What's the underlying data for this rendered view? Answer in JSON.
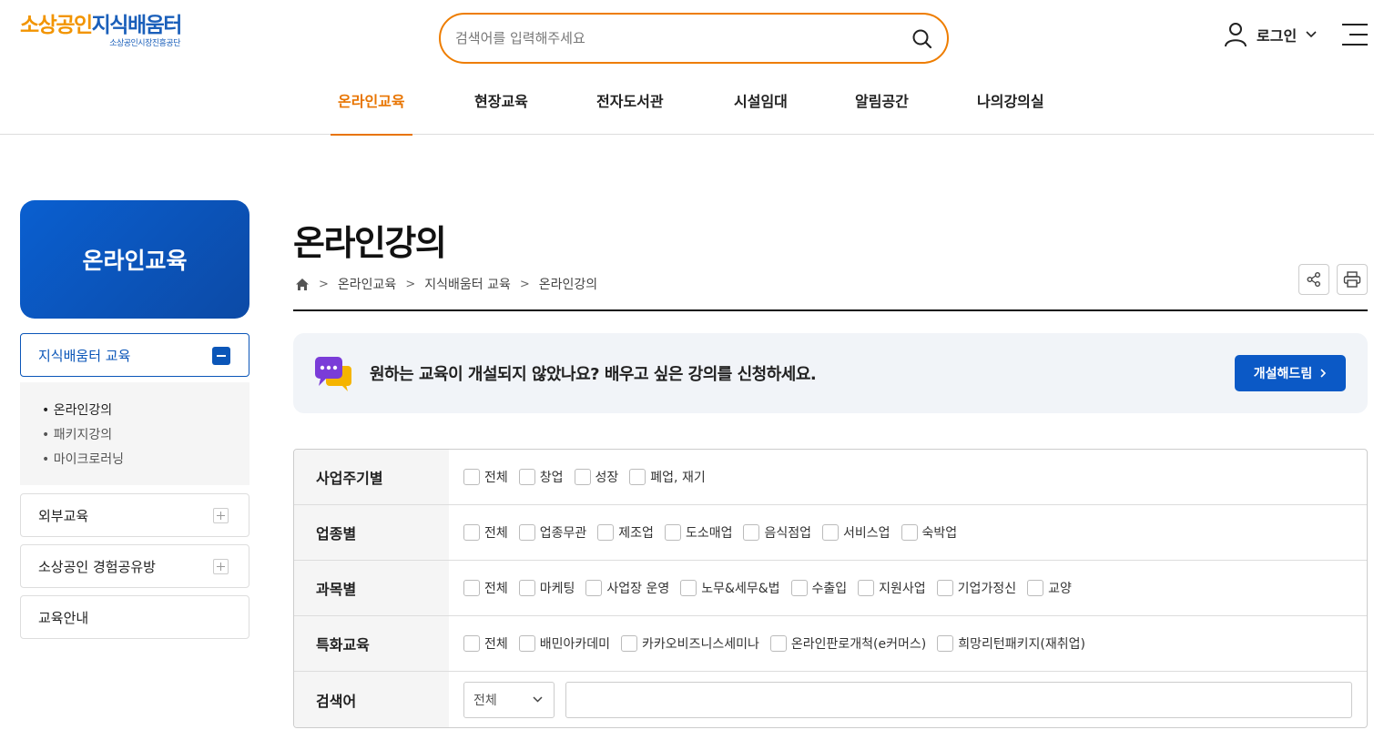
{
  "header": {
    "logo_main_orange": "소상공인",
    "logo_main_blue": "지식배움터",
    "logo_sub": "소상공인시장진흥공단",
    "search_placeholder": "검색어를 입력해주세요",
    "login_label": "로그인",
    "accent_color": "#ee7d00"
  },
  "gnb": {
    "items": [
      {
        "label": "온라인교육",
        "active": true
      },
      {
        "label": "현장교육"
      },
      {
        "label": "전자도서관"
      },
      {
        "label": "시설임대"
      },
      {
        "label": "알림공간"
      },
      {
        "label": "나의강의실"
      }
    ]
  },
  "sidebar": {
    "title": "온라인교육",
    "open_group": "지식배움터 교육",
    "sub_items": [
      "온라인강의",
      "패키지강의",
      "마이크로러닝"
    ],
    "groups": [
      "외부교육",
      "소상공인 경험공유방",
      "교육안내"
    ]
  },
  "content": {
    "title": "온라인강의",
    "breadcrumb": [
      "온라인교육",
      "지식배움터 교육",
      "온라인강의"
    ],
    "banner_text": "원하는 교육이 개설되지 않았나요? 배우고 싶은 강의를 신청하세요.",
    "banner_button": "개설해드림"
  },
  "filter": {
    "rows": [
      {
        "label": "사업주기별",
        "options": [
          "전체",
          "창업",
          "성장",
          "폐업, 재기"
        ]
      },
      {
        "label": "업종별",
        "options": [
          "전체",
          "업종무관",
          "제조업",
          "도소매업",
          "음식점업",
          "서비스업",
          "숙박업"
        ]
      },
      {
        "label": "과목별",
        "options": [
          "전체",
          "마케팅",
          "사업장 운영",
          "노무&세무&법",
          "수출입",
          "지원사업",
          "기업가정신",
          "교양"
        ]
      },
      {
        "label": "특화교육",
        "options": [
          "전체",
          "배민아카데미",
          "카카오비즈니스세미나",
          "온라인판로개척(e커머스)",
          "희망리턴패키지(재취업)"
        ]
      }
    ],
    "keyword_label": "검색어",
    "keyword_select": "전체"
  }
}
